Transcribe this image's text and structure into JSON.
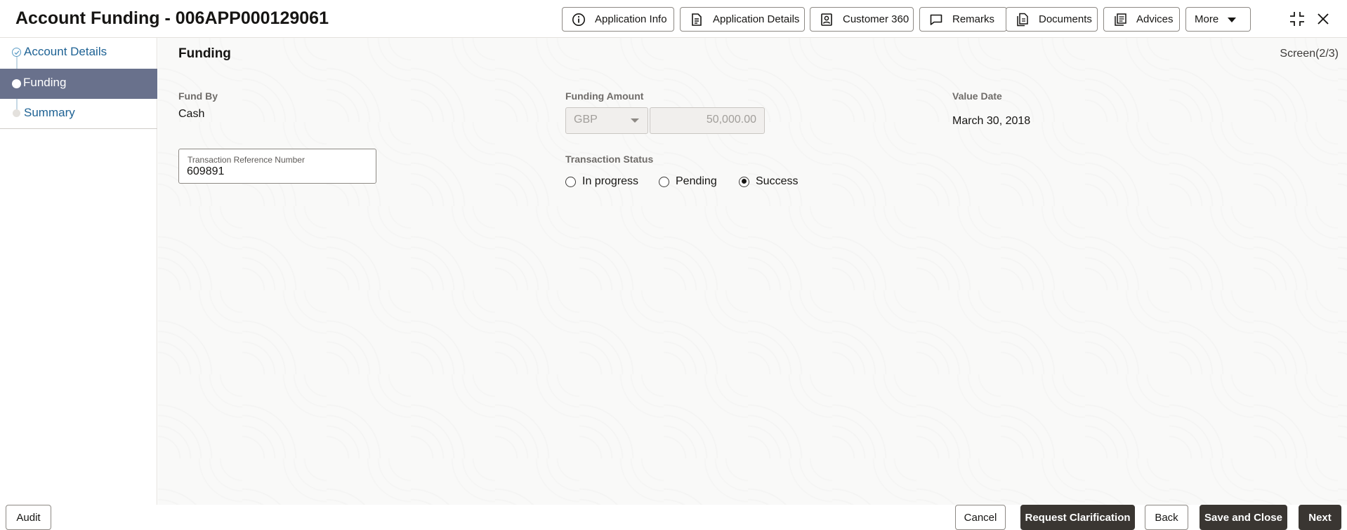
{
  "header": {
    "title": "Account Funding - 006APP000129061",
    "buttons": {
      "application_info": "Application Info",
      "application_details": "Application Details",
      "customer_360": "Customer 360",
      "remarks": "Remarks",
      "documents": "Documents",
      "advices": "Advices",
      "more": "More"
    }
  },
  "sidebar": {
    "steps": [
      {
        "label": "Account Details",
        "state": "completed"
      },
      {
        "label": "Funding",
        "state": "current"
      },
      {
        "label": "Summary",
        "state": "pending"
      }
    ]
  },
  "main": {
    "section_title": "Funding",
    "screen_counter": "Screen(2/3)",
    "fund_by": {
      "label": "Fund By",
      "value": "Cash"
    },
    "funding_amount": {
      "label": "Funding Amount",
      "currency": "GBP",
      "amount": "50,000.00"
    },
    "value_date": {
      "label": "Value Date",
      "value": "March 30, 2018"
    },
    "transaction_reference": {
      "label": "Transaction Reference Number",
      "value": "609891"
    },
    "transaction_status": {
      "label": "Transaction Status",
      "options": [
        "In progress",
        "Pending",
        "Success"
      ],
      "selected": "Success"
    }
  },
  "footer": {
    "audit": "Audit",
    "cancel": "Cancel",
    "request_clarification": "Request Clarification",
    "back": "Back",
    "save_and_close": "Save and Close",
    "next": "Next"
  },
  "colors": {
    "active_step_bg": "#69718c",
    "link": "#1e6294",
    "primary_button": "#3a3632",
    "page_bg": "#f9f9f8"
  }
}
